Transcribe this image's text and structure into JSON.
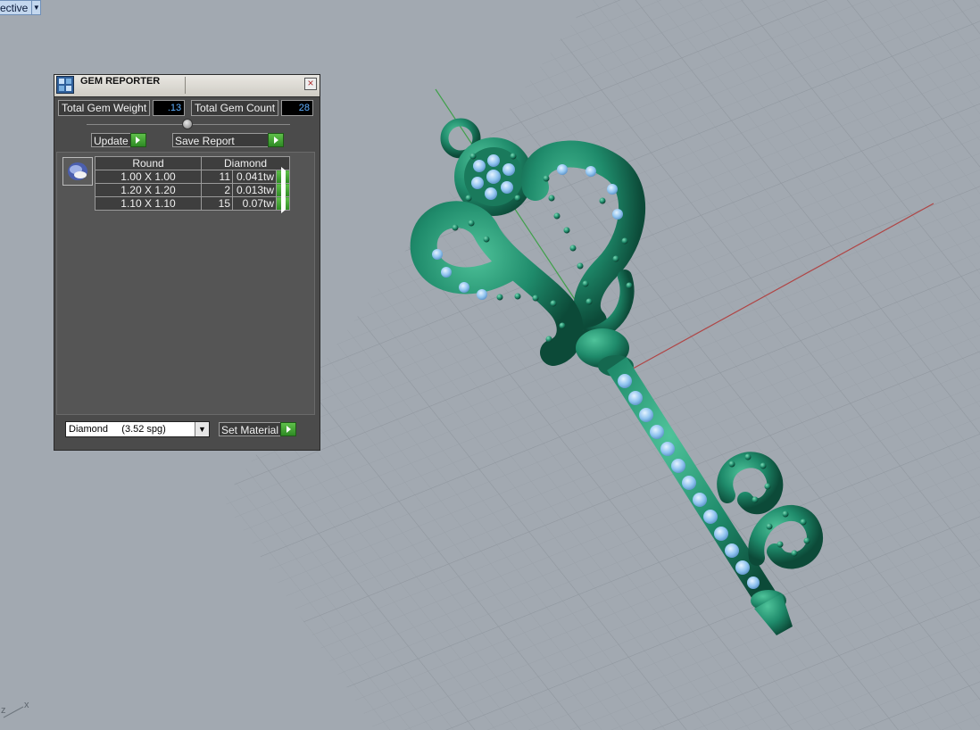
{
  "viewport": {
    "label": "ective",
    "axis_indicator": {
      "z": "z",
      "x": "x"
    }
  },
  "gem_reporter": {
    "title": "GEM REPORTER",
    "total_weight_label": "Total Gem Weight",
    "total_weight_value": ".13",
    "total_count_label": "Total Gem Count",
    "total_count_value": "28",
    "update_label": "Update",
    "save_report_label": "Save Report",
    "table": {
      "headers": [
        "Round",
        "Diamond"
      ],
      "rows": [
        {
          "size": "1.00 X 1.00",
          "qty": "11",
          "weight": "0.041tw"
        },
        {
          "size": "1.20 X 1.20",
          "qty": "2",
          "weight": "0.013tw"
        },
        {
          "size": "1.10 X 1.10",
          "qty": "15",
          "weight": "0.07tw"
        }
      ]
    },
    "material_select": "Diamond     (3.52 spg)",
    "set_material_label": "Set Material"
  },
  "colors": {
    "viewport_bg": "#a2a9b1",
    "metal": "#1f8b6b",
    "gem": "#8fc3ef",
    "axis_x": "#b04545",
    "axis_y": "#3fa04a",
    "accent_button": "#3aa02e"
  }
}
